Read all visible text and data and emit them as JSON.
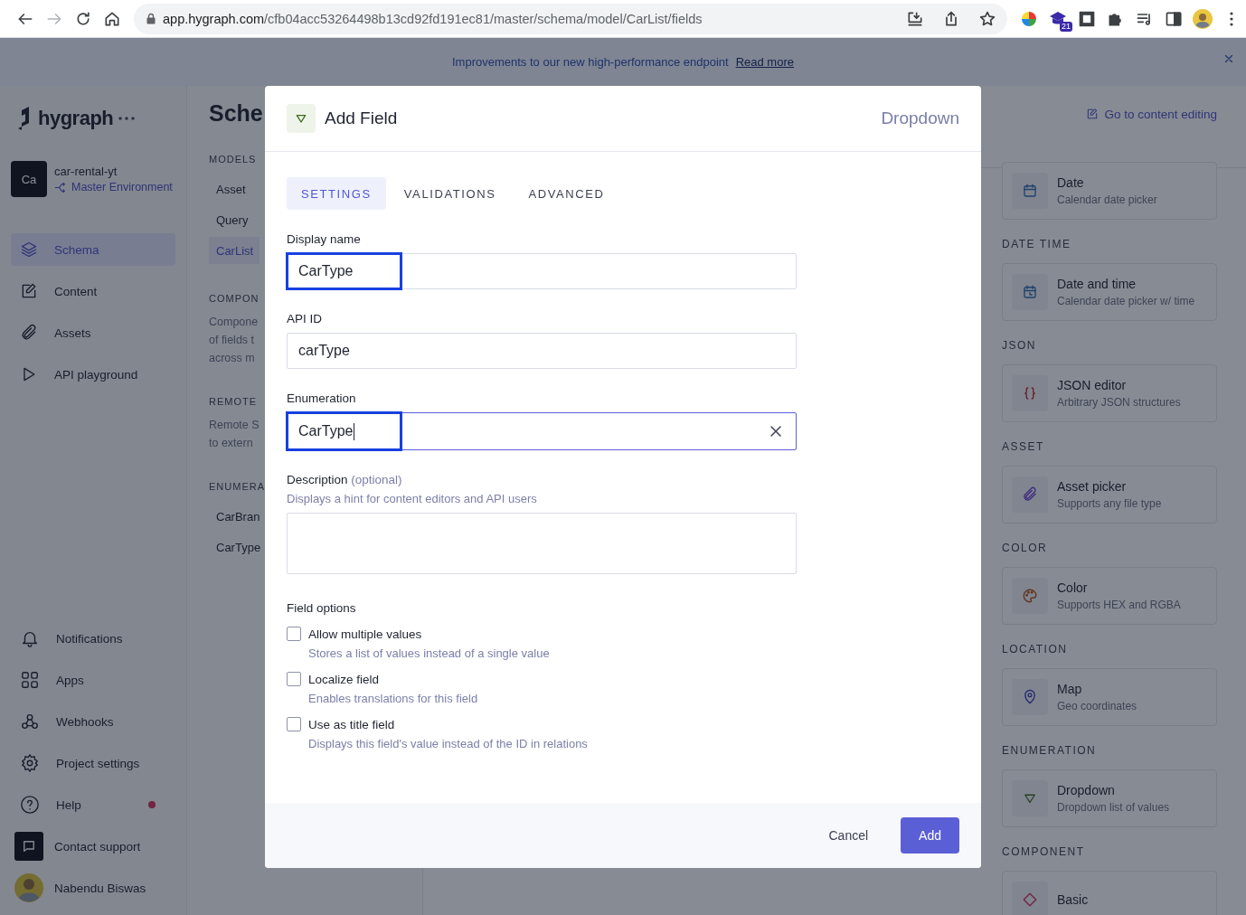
{
  "browser": {
    "url_host": "app.hygraph.com",
    "url_path": "/cfb04acc53264498b13cd92fd191ec81/master/schema/model/CarList/fields",
    "extension_badge": "21"
  },
  "banner": {
    "message": "Improvements to our new high-performance endpoint",
    "link": "Read more"
  },
  "sidebar": {
    "logo": "hygraph",
    "project": {
      "initials": "Ca",
      "name": "car-rental-yt",
      "environment": "Master Environment"
    },
    "nav": [
      {
        "label": "Schema",
        "selected": true
      },
      {
        "label": "Content",
        "selected": false
      },
      {
        "label": "Assets",
        "selected": false
      },
      {
        "label": "API playground",
        "selected": false
      }
    ],
    "bottom": [
      {
        "label": "Notifications",
        "dot": false
      },
      {
        "label": "Apps",
        "dot": false
      },
      {
        "label": "Webhooks",
        "dot": false
      },
      {
        "label": "Project settings",
        "dot": false
      },
      {
        "label": "Help",
        "dot": true
      },
      {
        "label": "Contact support",
        "dot": false
      }
    ],
    "user": {
      "name": "Nabendu Biswas"
    }
  },
  "schema_panel": {
    "title": "Sche",
    "sections": [
      {
        "heading": "MODELS",
        "items": [
          {
            "label": "Asset",
            "selected": false
          },
          {
            "label": "Query",
            "selected": false
          },
          {
            "label": "CarList",
            "selected": true
          }
        ]
      },
      {
        "heading": "COMPON",
        "description": "Compone\nof fields t\nacross m"
      },
      {
        "heading": "REMOTE",
        "description": "Remote S\nto extern"
      },
      {
        "heading": "ENUMERA",
        "items": [
          {
            "label": "CarBran",
            "selected": false
          },
          {
            "label": "CarType",
            "selected": false
          }
        ]
      }
    ]
  },
  "field_types": {
    "link": "Go to content editing",
    "sections": [
      {
        "cards": [
          {
            "name": "Date",
            "description": "Calendar date picker"
          }
        ]
      },
      {
        "heading": "DATE TIME",
        "cards": [
          {
            "name": "Date and time",
            "description": "Calendar date picker w/ time"
          }
        ]
      },
      {
        "heading": "JSON",
        "cards": [
          {
            "name": "JSON editor",
            "description": "Arbitrary JSON structures"
          }
        ]
      },
      {
        "heading": "ASSET",
        "cards": [
          {
            "name": "Asset picker",
            "description": "Supports any file type"
          }
        ]
      },
      {
        "heading": "COLOR",
        "cards": [
          {
            "name": "Color",
            "description": "Supports HEX and RGBA"
          }
        ]
      },
      {
        "heading": "LOCATION",
        "cards": [
          {
            "name": "Map",
            "description": "Geo coordinates"
          }
        ]
      },
      {
        "heading": "ENUMERATION",
        "cards": [
          {
            "name": "Dropdown",
            "description": "Dropdown list of values"
          }
        ]
      },
      {
        "heading": "COMPONENT",
        "cards": [
          {
            "name": "Basic"
          }
        ]
      }
    ]
  },
  "modal": {
    "title": "Add Field",
    "type_label": "Dropdown",
    "tabs": [
      {
        "label": "SETTINGS",
        "selected": true
      },
      {
        "label": "VALIDATIONS",
        "selected": false
      },
      {
        "label": "ADVANCED",
        "selected": false
      }
    ],
    "fields": [
      {
        "kind": "input",
        "label": "Display name",
        "value": "CarType",
        "highlighted": true,
        "focused": false,
        "clearable": false
      },
      {
        "kind": "input",
        "label": "API ID",
        "value": "carType",
        "highlighted": false,
        "focused": false,
        "clearable": false
      },
      {
        "kind": "input",
        "label": "Enumeration",
        "value": "CarType",
        "highlighted": true,
        "focused": true,
        "clearable": true
      },
      {
        "kind": "textarea",
        "label": "Description",
        "optional": "(optional)",
        "hint": "Displays a hint for content editors and API users"
      }
    ],
    "options_title": "Field options",
    "options": [
      {
        "label": "Allow multiple values",
        "hint": "Stores a list of values instead of a single value",
        "checked": false
      },
      {
        "label": "Localize field",
        "hint": "Enables translations for this field",
        "checked": false
      },
      {
        "label": "Use as title field",
        "hint": "Displays this field's value instead of the ID in relations",
        "checked": false
      }
    ],
    "buttons": [
      {
        "label": "Cancel",
        "kind": "secondary"
      },
      {
        "label": "Add",
        "kind": "primary"
      }
    ]
  }
}
